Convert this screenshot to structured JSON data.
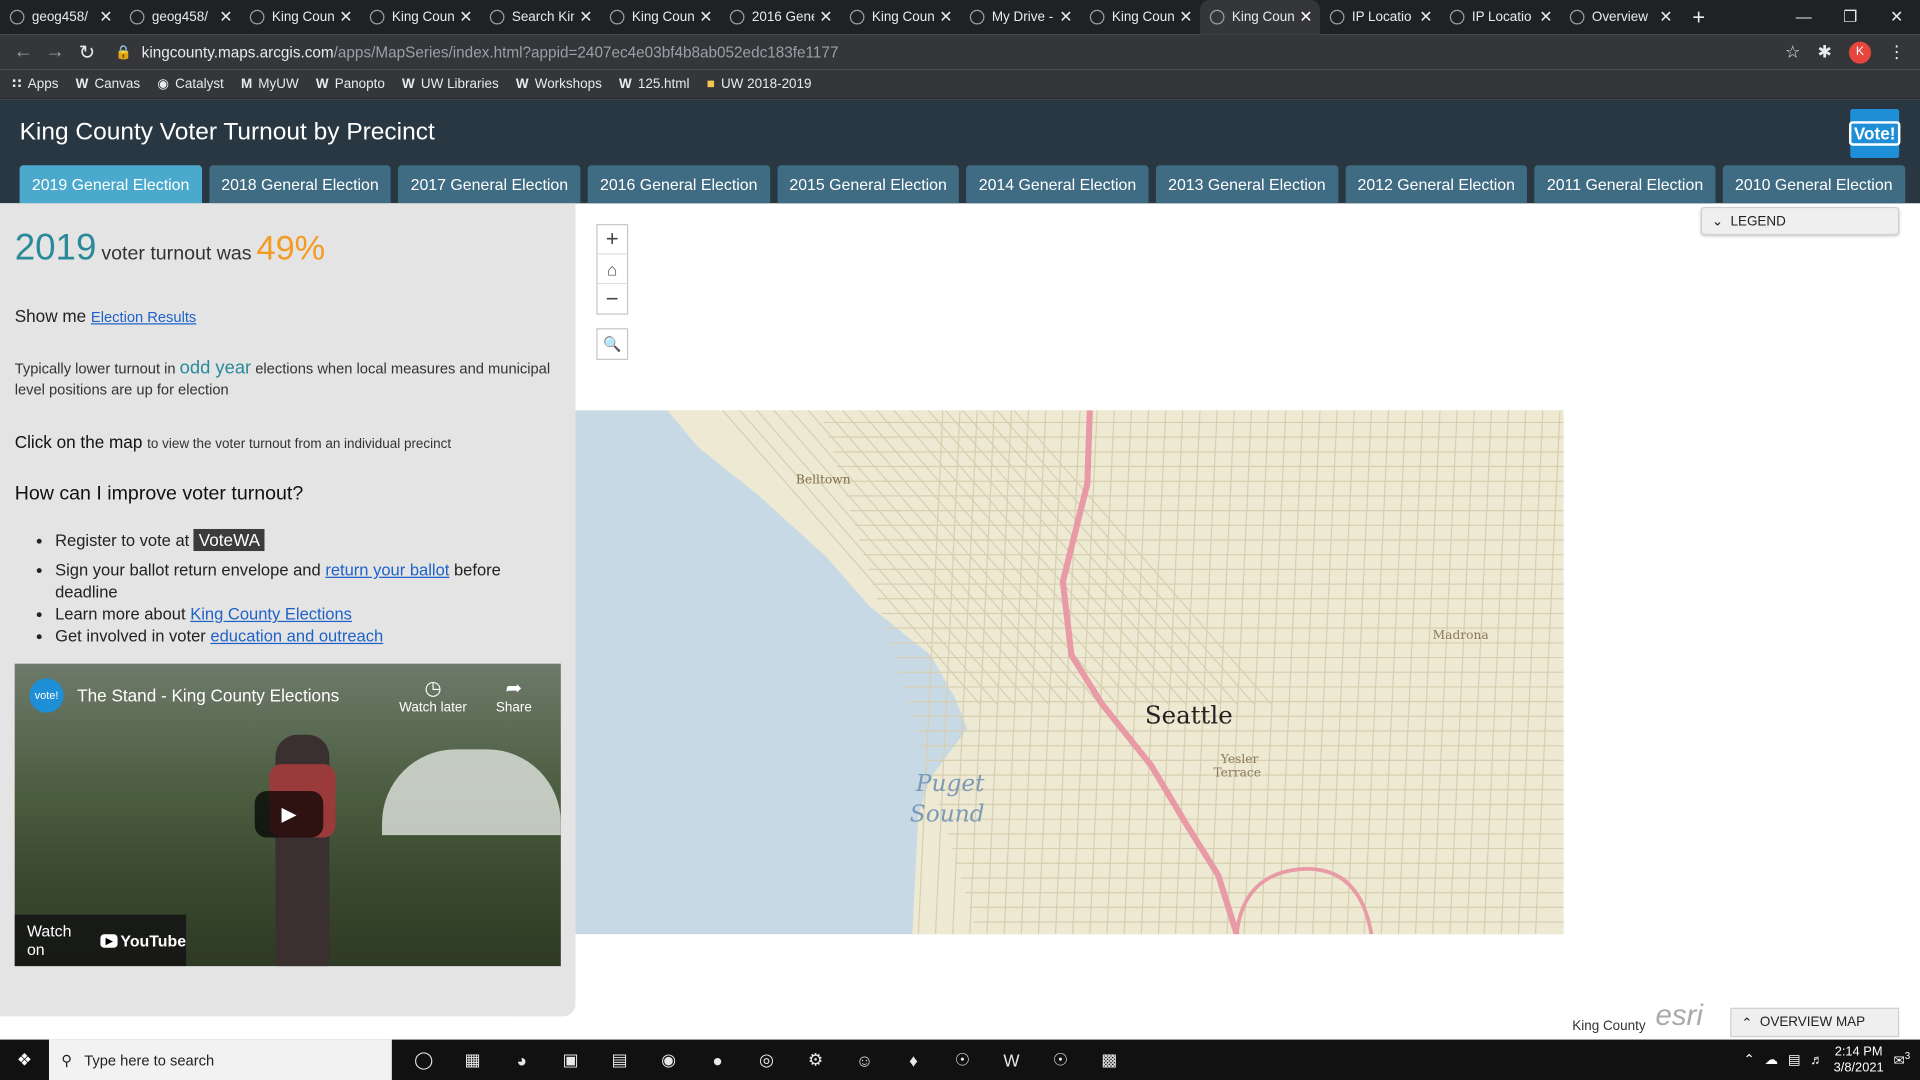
{
  "browser": {
    "tabs": [
      {
        "title": "geog458/",
        "active": false
      },
      {
        "title": "geog458/",
        "active": false
      },
      {
        "title": "King Coun",
        "active": false
      },
      {
        "title": "King Coun",
        "active": false
      },
      {
        "title": "Search Kin",
        "active": false
      },
      {
        "title": "King Coun",
        "active": false
      },
      {
        "title": "2016 Gene",
        "active": false
      },
      {
        "title": "King Coun",
        "active": false
      },
      {
        "title": "My Drive -",
        "active": false
      },
      {
        "title": "King Coun",
        "active": false
      },
      {
        "title": "King Coun",
        "active": true
      },
      {
        "title": "IP Locatio",
        "active": false
      },
      {
        "title": "IP Locatio",
        "active": false
      },
      {
        "title": "Overview",
        "active": false
      }
    ],
    "url_host": "kingcounty.maps.arcgis.com",
    "url_path": "/apps/MapSeries/index.html?appid=2407ec4e03bf4b8ab052edc183fe1177",
    "profile_initial": "K",
    "bookmarks": [
      {
        "label": "Apps",
        "icon": "apps-grid-icon"
      },
      {
        "label": "Canvas",
        "icon": "w-icon"
      },
      {
        "label": "Catalyst",
        "icon": "catalyst-icon"
      },
      {
        "label": "MyUW",
        "icon": "myuw-icon"
      },
      {
        "label": "Panopto",
        "icon": "w-icon"
      },
      {
        "label": "UW Libraries",
        "icon": "w-icon"
      },
      {
        "label": "Workshops",
        "icon": "w-icon"
      },
      {
        "label": "125.html",
        "icon": "w-icon"
      },
      {
        "label": "UW 2018-2019",
        "icon": "folder-icon"
      }
    ]
  },
  "app": {
    "title": "King County Voter Turnout by Precinct",
    "logo_text": "Vote!",
    "election_tabs": [
      "2019 General Election",
      "2018 General Election",
      "2017 General Election",
      "2016 General Election",
      "2015 General Election",
      "2014 General Election",
      "2013 General Election",
      "2012 General Election",
      "2011 General Election",
      "2010 General Election"
    ],
    "active_tab_index": 0
  },
  "panel": {
    "year": "2019",
    "turnout_mid": "voter turnout was",
    "turnout_pct": "49%",
    "showme_label": "Show me",
    "showme_link": "Election Results",
    "typ_pre": "Typically lower turnout in",
    "typ_emph": "odd year",
    "typ_post": "elections when local measures and municipal level positions are up for election",
    "click_bold": "Click on the map",
    "click_rest": "to view the voter turnout from an individual precinct",
    "how_heading": "How can I improve voter turnout?",
    "list": {
      "item1_text": "Register to vote at",
      "item1_badge": "VoteWA",
      "item2_pre": "Sign your ballot return envelope and",
      "item2_link": "return your ballot",
      "item2_post": "before deadline",
      "item3_pre": "Learn more about",
      "item3_link": "King County Elections",
      "item4_pre": "Get involved in voter",
      "item4_link": "education and outreach"
    },
    "video": {
      "logo": "vote!",
      "title": "The Stand - King County Elections",
      "watch_later": "Watch later",
      "share": "Share",
      "watch_on": "Watch on",
      "youtube": "YouTube"
    }
  },
  "map": {
    "labels": {
      "city": "Seattle",
      "water1": "Puget",
      "water2": "Sound",
      "belltown": "Belltown",
      "madrona": "Madrona",
      "yesler1": "Yesler",
      "yesler2": "Terrace"
    },
    "legend": "LEGEND",
    "attribution": "King County",
    "esri": "esri",
    "overview": "OVERVIEW MAP"
  },
  "taskbar": {
    "search_placeholder": "Type here to search",
    "time": "2:14 PM",
    "date": "3/8/2021",
    "notif_count": "3"
  },
  "colors": {
    "header": "#283741",
    "active_tab": "#4aa9cc",
    "tab": "#3f6b83",
    "year": "#2a8a9a",
    "percent": "#f39c24"
  }
}
